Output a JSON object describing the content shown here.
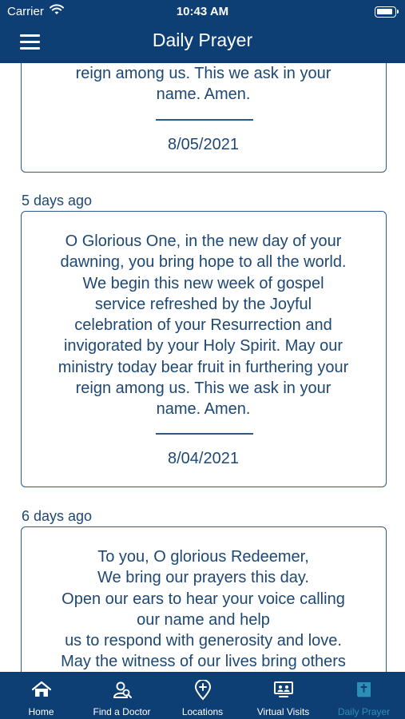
{
  "status_bar": {
    "carrier": "Carrier",
    "time": "10:43 AM"
  },
  "header": {
    "title": "Daily Prayer"
  },
  "feed": {
    "partial_card": {
      "text": "reign among us. This we ask in your\nname. Amen.",
      "date": "8/05/2021"
    },
    "entries": [
      {
        "ago": "5 days ago",
        "text": "O Glorious One, in the new day of your\ndawning, you bring hope to all the world.\nWe begin this  new week of gospel\nservice refreshed by the Joyful\ncelebration of your Resurrection and\ninvigorated by your Holy Spirit. May our\nministry today bear fruit in furthering your\nreign among us. This we ask in your\nname. Amen.",
        "date": "8/04/2021"
      },
      {
        "ago": "6 days ago",
        "text": "To you, O glorious Redeemer,\nWe bring our prayers this day.\nOpen our ears to hear your voice calling\nour name and help\nus to respond with generosity and love.\nMay the witness of our lives bring others"
      }
    ]
  },
  "tabbar": {
    "tabs": [
      {
        "label": "Home",
        "icon": "home-icon"
      },
      {
        "label": "Find a Doctor",
        "icon": "find-doctor-icon"
      },
      {
        "label": "Locations",
        "icon": "location-pin-icon"
      },
      {
        "label": "Virtual Visits",
        "icon": "virtual-visits-icon"
      },
      {
        "label": "Daily Prayer",
        "icon": "prayer-book-icon"
      }
    ],
    "active_index": 4
  },
  "colors": {
    "header_bg": "#0d3f75",
    "text": "#1e4874",
    "border": "#2a5a8c",
    "active_tab": "#2c8fb6"
  }
}
